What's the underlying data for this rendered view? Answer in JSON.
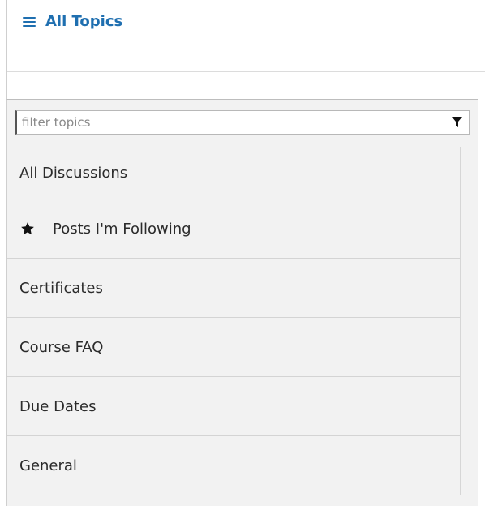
{
  "header": {
    "toggle_label": "All Topics"
  },
  "filter": {
    "placeholder": "filter topics",
    "value": ""
  },
  "topics": [
    {
      "label": "All Discussions"
    },
    {
      "label": "Posts I'm Following",
      "icon": "star-icon"
    },
    {
      "label": "Certificates"
    },
    {
      "label": "Course FAQ"
    },
    {
      "label": "Due Dates"
    },
    {
      "label": "General"
    }
  ],
  "colors": {
    "accent": "#1f6fb0",
    "panel_bg": "#f2f2f2"
  }
}
